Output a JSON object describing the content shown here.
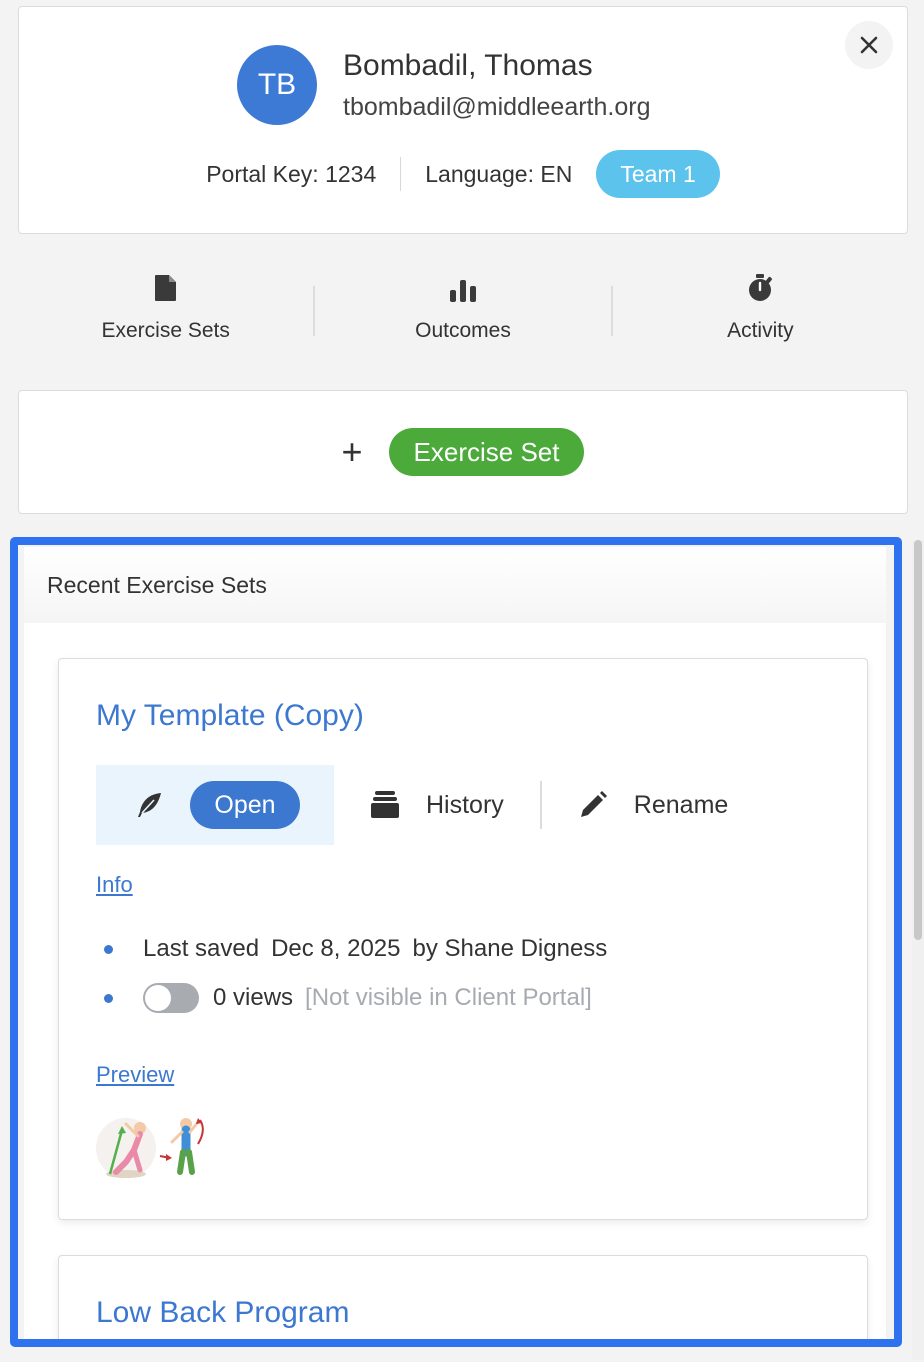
{
  "client": {
    "initials": "TB",
    "name": "Bombadil, Thomas",
    "email": "tbombadil@middleearth.org",
    "portal_key": "Portal Key: 1234",
    "language": "Language: EN",
    "team": "Team 1"
  },
  "nav": {
    "tabs": [
      {
        "label": "Exercise Sets",
        "icon": "file-icon"
      },
      {
        "label": "Outcomes",
        "icon": "bar-chart-icon"
      },
      {
        "label": "Activity",
        "icon": "stopwatch-icon"
      }
    ]
  },
  "add": {
    "plus": "+",
    "button_label": "Exercise Set"
  },
  "recent": {
    "header": "Recent Exercise Sets",
    "sets": [
      {
        "title": "My Template (Copy)",
        "open_label": "Open",
        "history_label": "History",
        "rename_label": "Rename",
        "info_link": "Info",
        "last_saved_label": "Last saved",
        "last_saved_date": "Dec 8, 2025",
        "saved_by": "by Shane Digness",
        "views": "0 views",
        "visibility_note": "[Not visible in Client Portal]",
        "portal_visible": false,
        "preview_link": "Preview"
      },
      {
        "title": "Low Back Program"
      }
    ]
  },
  "colors": {
    "avatar": "#3d7ad6",
    "team_badge": "#5cc3ec",
    "add_button": "#4caa3b",
    "link_blue": "#3c78d0",
    "highlight": "#2f72ef"
  }
}
